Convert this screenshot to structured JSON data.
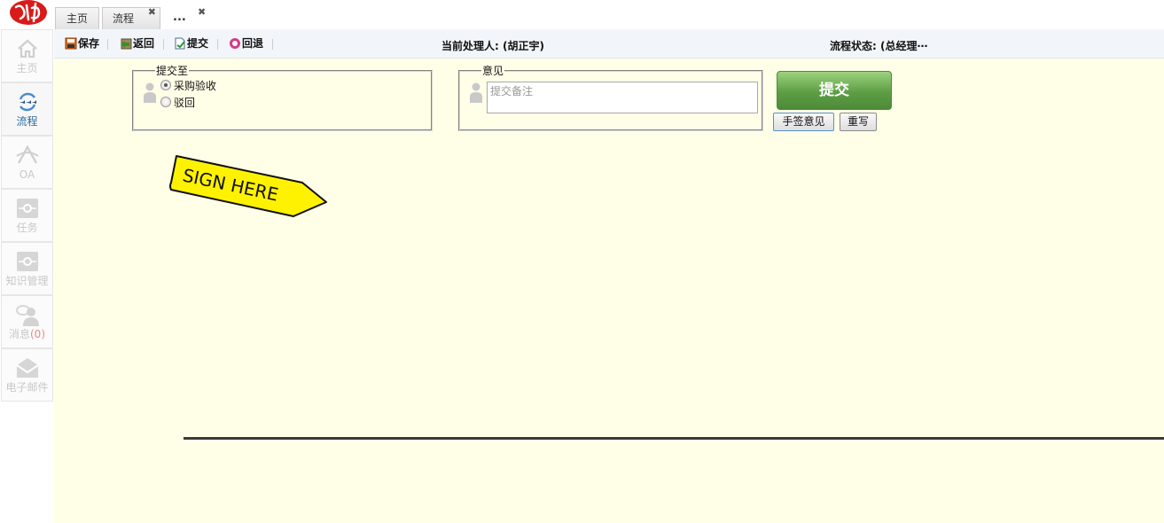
{
  "tabs": {
    "home": "主页",
    "flow": "流程",
    "close_glyph": "✖",
    "overflow": "...",
    "overflow_close": "✖"
  },
  "sidebar": {
    "items": [
      {
        "label": "主页",
        "icon": "home-icon"
      },
      {
        "label": "流程",
        "icon": "workflow-icon"
      },
      {
        "label": "OA",
        "icon": "oa-icon"
      },
      {
        "label": "任务",
        "icon": "task-icon"
      },
      {
        "label": "知识管理",
        "icon": "knowledge-icon"
      },
      {
        "label": "消息",
        "badge": "(0)",
        "icon": "message-icon"
      },
      {
        "label": "电子邮件",
        "icon": "email-icon"
      }
    ]
  },
  "toolbar": {
    "save": "保存",
    "back": "返回",
    "submit": "提交",
    "rollback": "回退",
    "current_handler": "当前处理人: (胡正宇)",
    "flow_status": "流程状态: (总经理⋯"
  },
  "form": {
    "submit_to": {
      "legend": "提交至",
      "options": [
        "采购验收",
        "驳回"
      ],
      "selected": "采购验收"
    },
    "opinion": {
      "legend": "意见",
      "placeholder": "提交备注"
    },
    "submit_button": "提交",
    "handwrite_button": "手签意见",
    "reset_button": "重写",
    "sign_label": "SIGN HERE"
  },
  "colors": {
    "main_bg": "#ffffe8",
    "toolbar_bg": "#f2f6fb",
    "submit_green": "#5d9e45",
    "sign_yellow": "#fff200",
    "active_side": "#2d6aa0"
  }
}
